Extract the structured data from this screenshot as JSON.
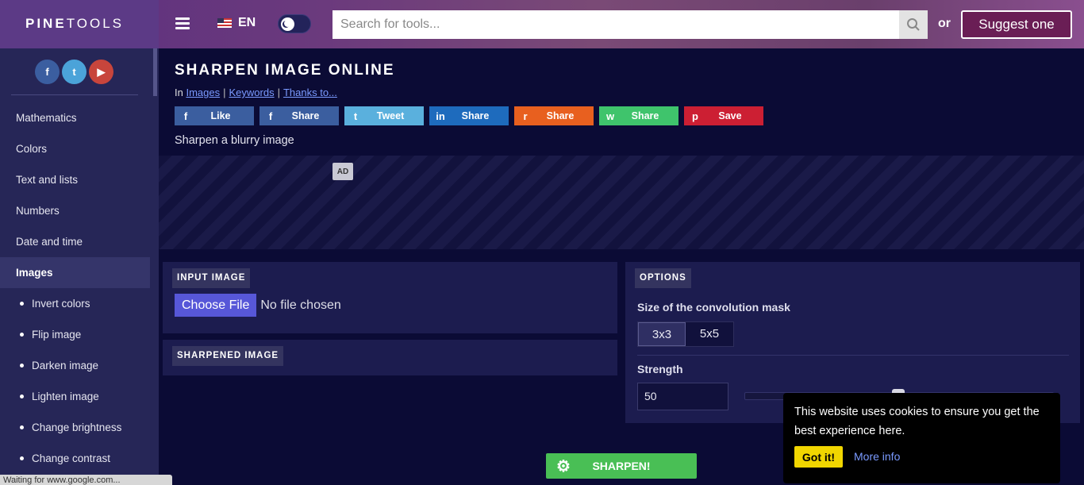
{
  "header": {
    "logo_bold": "PINE",
    "logo_thin": "TOOLS",
    "language": "EN",
    "search_placeholder": "Search for tools...",
    "or_text": "or",
    "suggest_label": "Suggest one"
  },
  "sidebar": {
    "social": [
      "f",
      "t",
      "▶"
    ],
    "items": [
      {
        "label": "Mathematics"
      },
      {
        "label": "Colors"
      },
      {
        "label": "Text and lists"
      },
      {
        "label": "Numbers"
      },
      {
        "label": "Date and time"
      },
      {
        "label": "Images"
      }
    ],
    "subitems": [
      {
        "label": "Invert colors"
      },
      {
        "label": "Flip image"
      },
      {
        "label": "Darken image"
      },
      {
        "label": "Lighten image"
      },
      {
        "label": "Change brightness"
      },
      {
        "label": "Change contrast"
      }
    ],
    "status_text": "Waiting for www.google.com..."
  },
  "page": {
    "title": "SHARPEN IMAGE ONLINE",
    "breadcrumb_prefix": "In",
    "breadcrumb_links": [
      "Images",
      "Keywords",
      "Thanks to..."
    ],
    "description": "Sharpen a blurry image",
    "ad_badge": "AD"
  },
  "share": [
    {
      "label": "Like",
      "icon": "f",
      "icon_name": "facebook-icon",
      "color": "#3b5e9f"
    },
    {
      "label": "Share",
      "icon": "f",
      "icon_name": "facebook-icon",
      "color": "#3b5e9f"
    },
    {
      "label": "Tweet",
      "icon": "t",
      "icon_name": "twitter-icon",
      "color": "#5ab0dd"
    },
    {
      "label": "Share",
      "icon": "in",
      "icon_name": "linkedin-icon",
      "color": "#1e6bbd"
    },
    {
      "label": "Share",
      "icon": "r",
      "icon_name": "reddit-icon",
      "color": "#e8601f"
    },
    {
      "label": "Share",
      "icon": "w",
      "icon_name": "whatsapp-icon",
      "color": "#3fc46c"
    },
    {
      "label": "Save",
      "icon": "p",
      "icon_name": "pinterest-icon",
      "color": "#cc1f33"
    }
  ],
  "input_panel": {
    "label": "INPUT IMAGE",
    "choose_file": "Choose File",
    "no_file": "No file chosen"
  },
  "output_panel": {
    "label": "SHARPENED IMAGE"
  },
  "options": {
    "label": "OPTIONS",
    "mask_label": "Size of the convolution mask",
    "mask_options": [
      "3x3",
      "5x5"
    ],
    "mask_selected": "3x3",
    "strength_label": "Strength",
    "strength_value": "50"
  },
  "action": {
    "sharpen_label": "SHARPEN!"
  },
  "cookie": {
    "message": "This website uses cookies to ensure you get the best experience here.",
    "accept": "Got it!",
    "more": "More info"
  },
  "colors": {
    "background": "#0b0b35",
    "sidebar": "#262657",
    "panel": "#1c1c4f",
    "accent_button": "#5757d8",
    "sharpen_button": "#49bf55",
    "cookie_accept": "#f1d600"
  }
}
